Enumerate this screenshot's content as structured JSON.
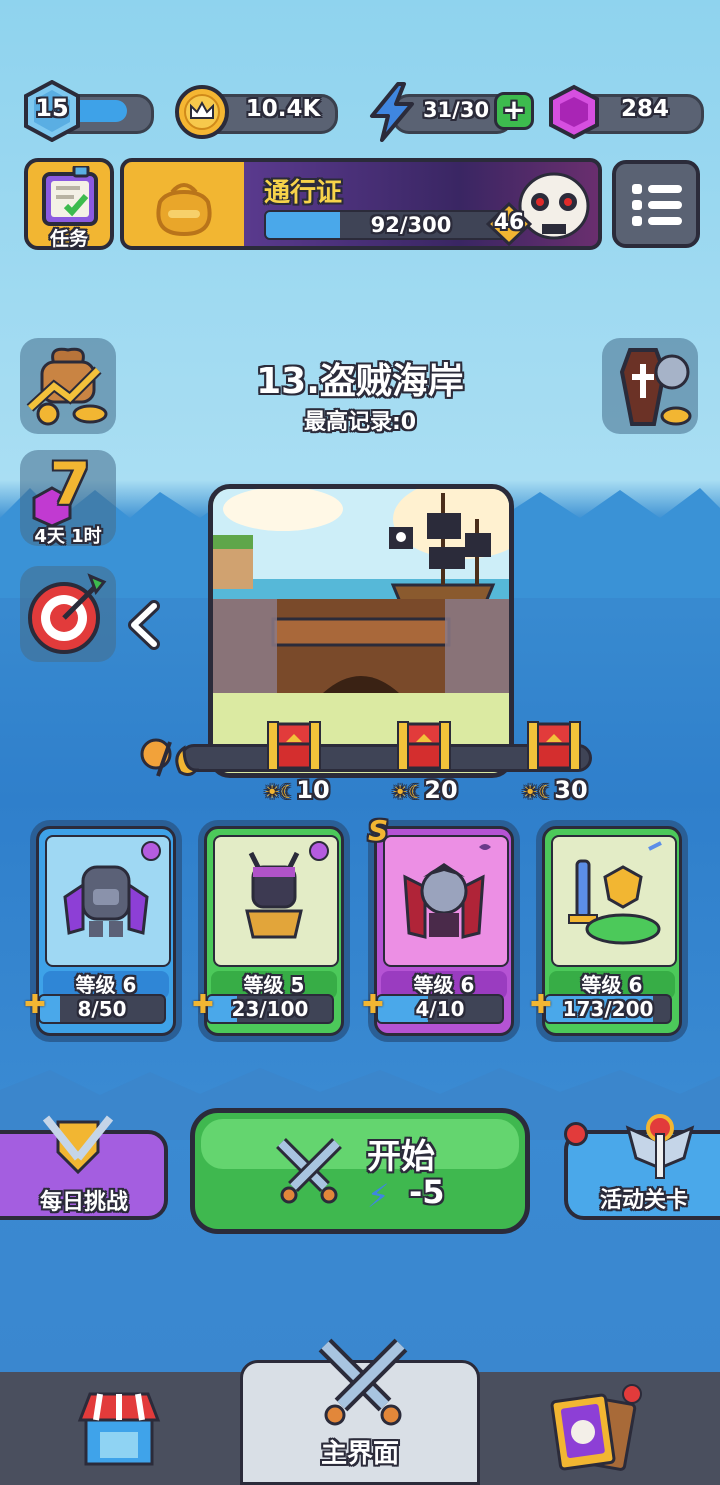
{
  "player": {
    "level": "15",
    "level_fill": 0.75
  },
  "coins": {
    "value": "10.4K"
  },
  "energy": {
    "value": "31/30",
    "add_label": "+"
  },
  "gems": {
    "value": "284"
  },
  "tasks": {
    "label": "任务"
  },
  "pass": {
    "title": "通行证",
    "progress": "92/300",
    "progress_fraction": 0.31,
    "level": "46"
  },
  "stage": {
    "title": "13.盗贼海岸",
    "record": "最高记录:0"
  },
  "timer_event": {
    "number": "7",
    "remaining": "4天 1时"
  },
  "rewards": [
    {
      "days": "10"
    },
    {
      "days": "20"
    },
    {
      "days": "30"
    }
  ],
  "heroes": [
    {
      "level": "等级 6",
      "progress": "8/50",
      "fill": 0.16,
      "color": "blue"
    },
    {
      "level": "等级 5",
      "progress": "23/100",
      "fill": 0.23,
      "color": "green"
    },
    {
      "level": "等级 6",
      "progress": "4/10",
      "fill": 0.4,
      "color": "purple",
      "rank": "S"
    },
    {
      "level": "等级 6",
      "progress": "173/200",
      "fill": 0.865,
      "color": "green"
    }
  ],
  "buttons": {
    "daily": "每日挑战",
    "start": "开始",
    "start_cost": "-5",
    "event": "活动关卡"
  },
  "nav": {
    "main": "主界面"
  },
  "colors": {
    "sky": "#a9def3",
    "sea": "#2f7fcb",
    "start_green": "#4cc95a",
    "gem_purple": "#c13ad1",
    "coin_gold": "#f2b632"
  }
}
